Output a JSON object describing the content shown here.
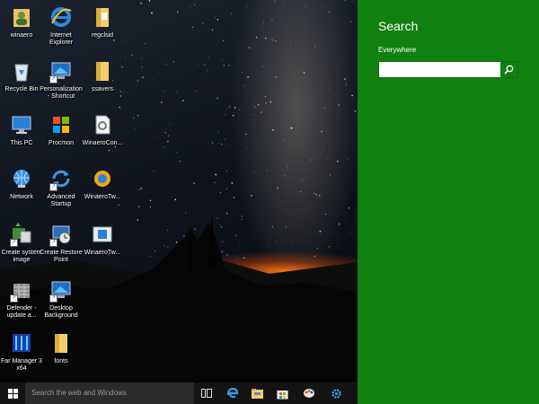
{
  "desktop": {
    "icons": [
      {
        "label": "winaero",
        "icon": "user-folder-icon"
      },
      {
        "label": "Internet\nExplorer",
        "icon": "internet-explorer-icon"
      },
      {
        "label": "regclsid",
        "icon": "folder-icon"
      },
      {
        "label": "Recycle Bin",
        "icon": "recycle-bin-icon"
      },
      {
        "label": "Personalization\n- Shortcut",
        "icon": "personalization-icon"
      },
      {
        "label": "ssavers",
        "icon": "folder-icon"
      },
      {
        "label": "This PC",
        "icon": "computer-icon"
      },
      {
        "label": "Procmon",
        "icon": "procmon-icon"
      },
      {
        "label": "WinaeroCon...",
        "icon": "document-icon"
      },
      {
        "label": "Network",
        "icon": "network-icon"
      },
      {
        "label": "Advanced\nStartup",
        "icon": "refresh-icon"
      },
      {
        "label": "WinaeroTw...",
        "icon": "winaero-tweaker-icon"
      },
      {
        "label": "Create system\nimage",
        "icon": "system-image-icon"
      },
      {
        "label": "Create Restore\nPoint",
        "icon": "restore-point-icon"
      },
      {
        "label": "WinaeroTw...",
        "icon": "window-icon"
      },
      {
        "label": "Defender -\nupdate a...",
        "icon": "defender-icon"
      },
      {
        "label": "Desktop\nBackground",
        "icon": "desktop-background-icon"
      },
      {
        "label": "Far Manager 3\nx64",
        "icon": "far-manager-icon"
      },
      {
        "label": "fonts",
        "icon": "folder-icon"
      }
    ]
  },
  "taskbar": {
    "search_placeholder": "Search the web and Windows",
    "icons": [
      "task-view-icon",
      "edge-icon",
      "file-explorer-icon",
      "store-icon",
      "paint-icon",
      "settings-gear-icon"
    ]
  },
  "search_panel": {
    "title": "Search",
    "scope": "Everywhere",
    "input_value": "",
    "background_color": "#12800f"
  }
}
